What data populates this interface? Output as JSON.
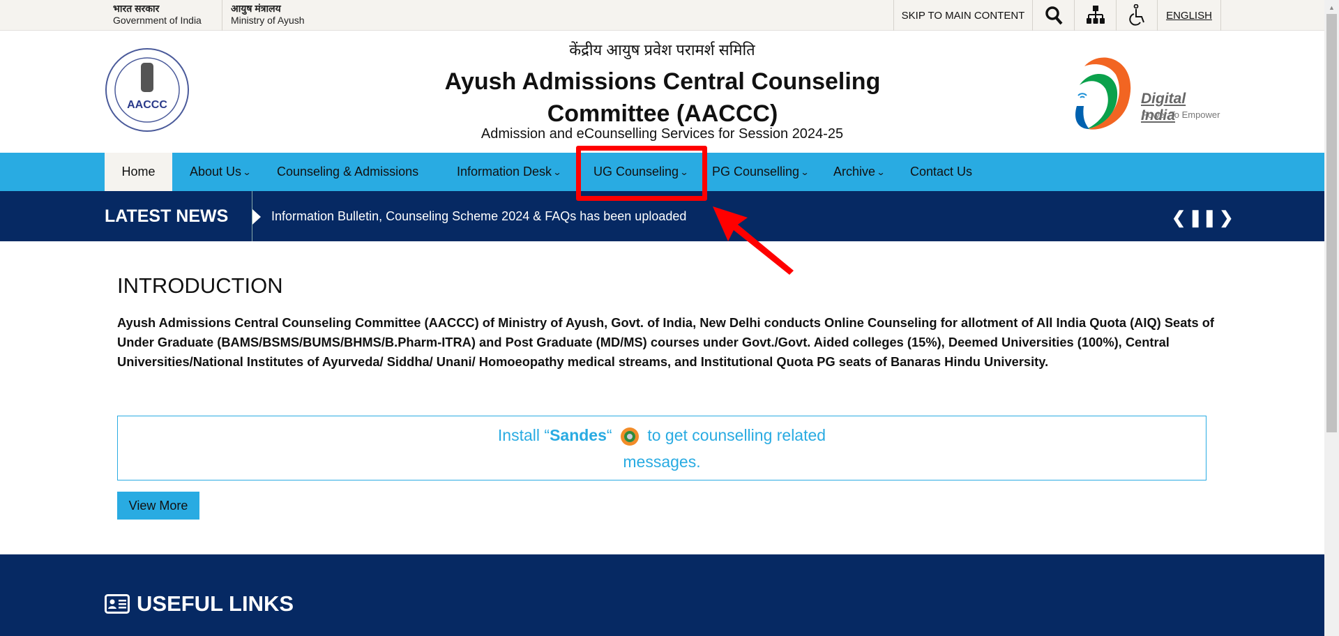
{
  "topbar": {
    "gov_hindi": "भारत सरकार",
    "gov_english": "Government of India",
    "ministry_hindi": "आयुष मंत्रालय",
    "ministry_english": "Ministry of Ayush",
    "skip_label": "SKIP TO MAIN CONTENT",
    "language_label": "ENGLISH"
  },
  "header": {
    "hindi_title": "केंद्रीय आयुष प्रवेश परामर्श समिति",
    "title": "Ayush Admissions Central Counseling Committee (AACCC)",
    "subtitle": "Admission and eCounselling Services for Session 2024-25",
    "logo_text": "AACCC",
    "digital_india": "Digital India",
    "digital_india_tagline": "Power To Empower"
  },
  "nav": {
    "items": [
      {
        "label": "Home",
        "active": true
      },
      {
        "label": "About Us",
        "dropdown": true
      },
      {
        "label": "Counseling & Admissions"
      },
      {
        "label": "Information Desk",
        "dropdown": true
      },
      {
        "label": "UG Counseling",
        "dropdown": true,
        "highlighted": true
      },
      {
        "label": "PG Counselling",
        "dropdown": true
      },
      {
        "label": "Archive",
        "dropdown": true
      },
      {
        "label": "Contact Us"
      }
    ]
  },
  "news": {
    "title": "LATEST NEWS",
    "item": "Information Bulletin, Counseling Scheme 2024 & FAQs has been uploaded"
  },
  "intro": {
    "heading": "INTRODUCTION",
    "text": "Ayush Admissions Central Counseling Committee (AACCC) of Ministry of Ayush, Govt. of India, New Delhi conducts Online Counseling for allotment of All India Quota (AIQ) Seats of Under Graduate (BAMS/BSMS/BUMS/BHMS/B.Pharm-ITRA) and Post Graduate (MD/MS) courses under Govt./Govt. Aided colleges (15%), Deemed Universities (100%), Central Universities/National Institutes of Ayurveda/ Siddha/ Unani/ Homoeopathy medical streams, and Institutional Quota PG seats of Banaras Hindu University."
  },
  "sandes": {
    "prefix": "Install “",
    "app": "Sandes",
    "suffix": "“",
    "rest": "to get counselling related messages."
  },
  "view_more": "View More",
  "footer": {
    "useful_links": "USEFUL LINKS"
  },
  "colors": {
    "nav": "#29abe2",
    "news": "#062963",
    "topbar": "#f5f3ef",
    "highlight": "#ff0000"
  }
}
